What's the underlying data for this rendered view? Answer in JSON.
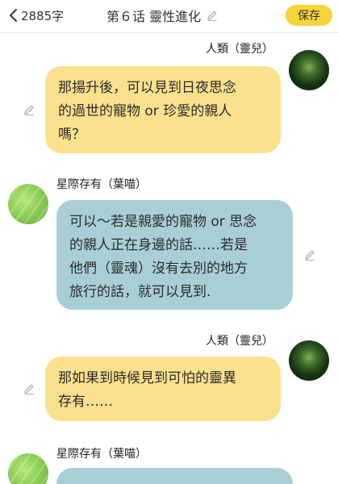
{
  "header": {
    "back_label": "2885字",
    "title": "第６话 靈性進化",
    "save_label": "保存"
  },
  "messages": [
    {
      "speaker": "人類（靈兒）",
      "side": "right",
      "bubble_color": "#fbe18d",
      "text": "那揚升後，可以見到日夜思念\n的過世的寵物 or 珍愛的親人\n嗎？"
    },
    {
      "speaker": "星際存有（葉喵）",
      "side": "left",
      "bubble_color": "#a9cfd6",
      "text": "可以～若是親愛的寵物 or 思念\n的親人正在身邊的話……若是\n他們（靈魂）沒有去別的地方\n旅行的話，就可以見到."
    },
    {
      "speaker": "人類（靈兒）",
      "side": "right",
      "bubble_color": "#fbe18d",
      "text": "那如果到時候見到可怕的靈異\n存有……"
    },
    {
      "speaker": "星際存有（葉喵）",
      "side": "left",
      "bubble_color": "#a9cfd6",
      "text": ""
    }
  ],
  "colors": {
    "accent": "#f7d53a",
    "user_bubble": "#fbe18d",
    "assistant_bubble": "#a9cfd6",
    "icon_gray": "#b5b5b5"
  }
}
